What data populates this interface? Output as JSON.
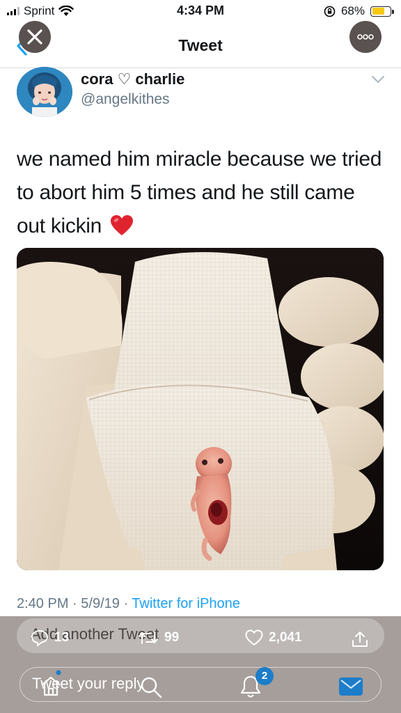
{
  "status_bar": {
    "carrier": "Sprint",
    "time": "4:34 PM",
    "battery_percent": "68%",
    "battery_level": 0.68,
    "battery_color": "#f5c814"
  },
  "nav": {
    "title": "Tweet",
    "back_icon": "chevron-left-icon",
    "close_icon": "close-icon",
    "more_icon": "more-icon"
  },
  "tweet": {
    "author_name": "cora ♡ charlie",
    "author_handle": "@angelkithes",
    "text": "we named him miracle because we tried to abort him 5 times and he still came out kickin",
    "emoji": "red-heart",
    "meta": {
      "time": "2:40 PM",
      "date": "5/9/19",
      "source": "Twitter for iPhone"
    }
  },
  "overlay": {
    "add_tweet_label": "Add another Tweet",
    "reply_count": "13",
    "retweet_count": "99",
    "like_count": "2,041",
    "reply_placeholder": "Tweet your reply",
    "notification_badge": "2"
  },
  "colors": {
    "link_blue": "#1da1f2",
    "overlay_gray": "#a59e9a",
    "mail_blue": "#1d7dc9"
  }
}
